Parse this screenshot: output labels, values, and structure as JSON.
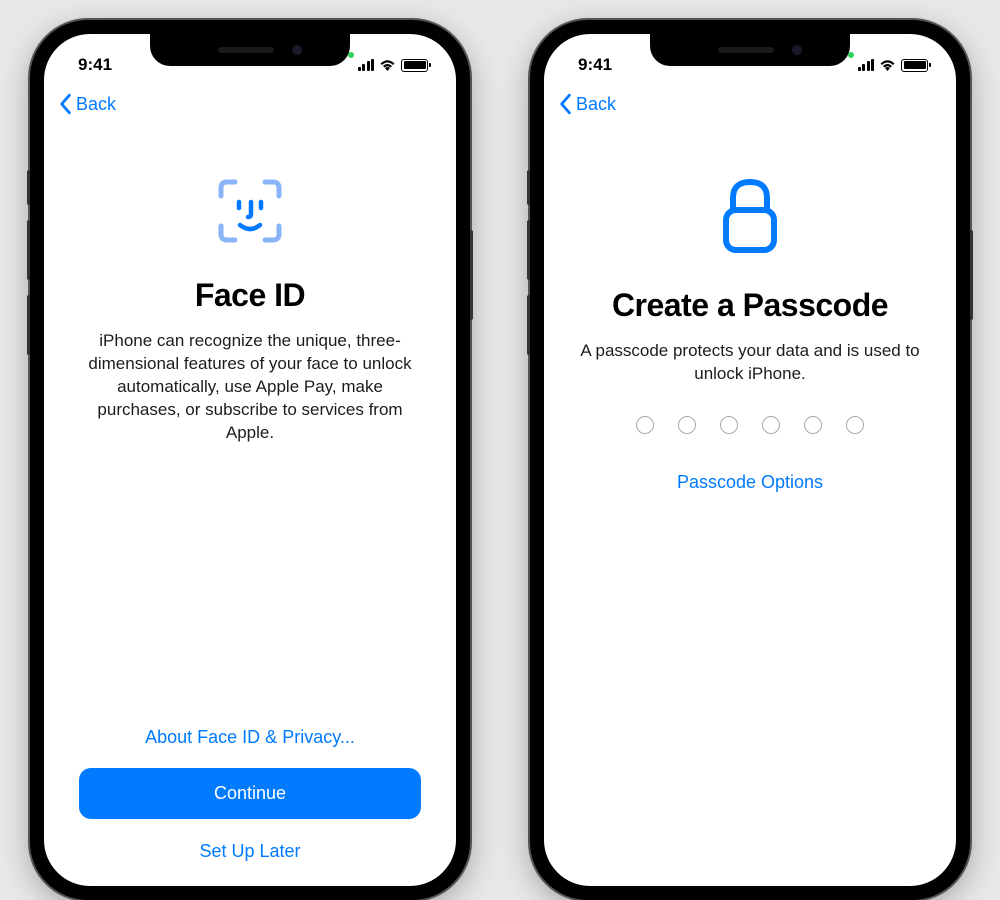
{
  "status": {
    "time": "9:41"
  },
  "nav": {
    "back": "Back"
  },
  "left_screen": {
    "title": "Face ID",
    "description": "iPhone can recognize the unique, three-dimensional features of your face to unlock automatically, use Apple Pay, make purchases, or subscribe to services from Apple.",
    "about_link": "About Face ID & Privacy...",
    "continue_button": "Continue",
    "later_link": "Set Up Later"
  },
  "right_screen": {
    "title": "Create a Passcode",
    "description": "A passcode protects your data and is used to unlock iPhone.",
    "passcode_digits": 6,
    "options_link": "Passcode Options"
  },
  "colors": {
    "accent": "#007aff"
  }
}
